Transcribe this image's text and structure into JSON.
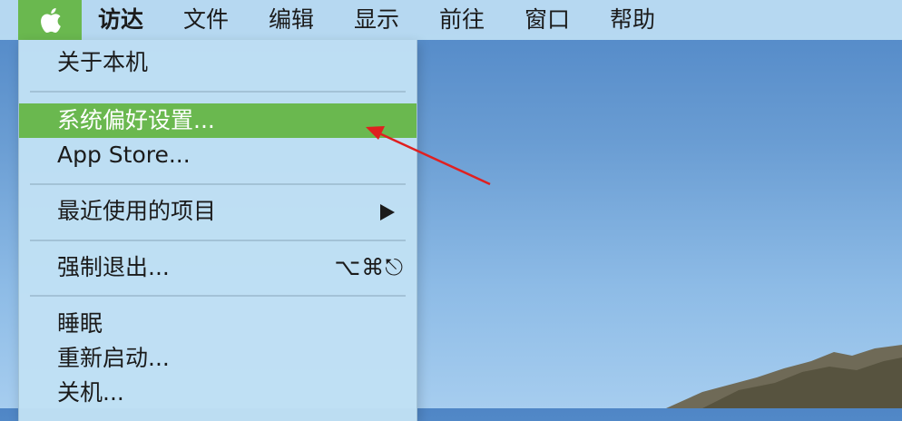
{
  "menubar": {
    "apple_icon": "apple-logo",
    "items": [
      "访达",
      "文件",
      "编辑",
      "显示",
      "前往",
      "窗口",
      "帮助"
    ]
  },
  "apple_menu": {
    "about": "关于本机",
    "system_prefs": "系统偏好设置...",
    "app_store": "App Store...",
    "recent_items": "最近使用的项目",
    "force_quit": "强制退出...",
    "force_quit_shortcut": "⌥⌘⎋",
    "sleep": "睡眠",
    "restart": "重新启动...",
    "shutdown": "关机..."
  },
  "colors": {
    "highlight": "#6ab84f",
    "annotation_arrow": "#e02020"
  }
}
